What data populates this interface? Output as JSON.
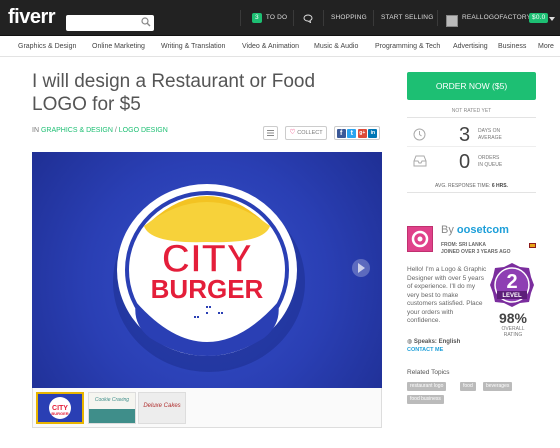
{
  "header": {
    "logo": "fiverr",
    "search_placeholder": "",
    "todo_count": "3",
    "todo_label": "TO DO",
    "shopping": "SHOPPING",
    "start_selling": "START SELLING",
    "username": "REALLOGOFACTORY",
    "balance": "$0.0"
  },
  "categories": [
    "Graphics & Design",
    "Online Marketing",
    "Writing & Translation",
    "Video & Animation",
    "Music & Audio",
    "Programming & Tech",
    "Advertising",
    "Business",
    "More"
  ],
  "gig": {
    "title": "I will design a Restaurant or Food LOGO for $5",
    "crumb_prefix": "IN",
    "crumb_cat": "GRAPHICS & DESIGN",
    "crumb_sep": "/",
    "crumb_sub": "LOGO DESIGN",
    "collect": "COLLECT",
    "logo_word1": "CITY",
    "logo_word2": "BURGER",
    "thumb_2_text": "Cookie Craving",
    "thumb_3_text": "Deluxe Cakes"
  },
  "sidebar": {
    "order_button": "ORDER NOW ($5)",
    "rating_status": "NOT RATED YET",
    "days_value": "3",
    "days_label_1": "DAYS ON",
    "days_label_2": "AVERAGE",
    "orders_value": "0",
    "orders_label_1": "ORDERS",
    "orders_label_2": "IN QUEUE",
    "response_label": "AVG. RESPONSE TIME:",
    "response_value": "6 HRS.",
    "by": "By",
    "seller_name": "oosetcom",
    "from": "FROM: SRI LANKA",
    "joined": "JOINED OVER 3 YEARS AGO",
    "bio": "Hello! I'm a Logo & Graphic Designer with over 5 years of experience. I'll do my very best to make customers satisfied. Place your orders with confidence.",
    "level_number": "2",
    "level_label": "LEVEL",
    "rating_pct": "98%",
    "overall_1": "OVERALL",
    "overall_2": "RATING",
    "speaks": "Speaks: English",
    "contact": "CONTACT ME",
    "related_title": "Related Topics",
    "tags": [
      "restaurant logo",
      "food",
      "beverages",
      "food business"
    ]
  },
  "colors": {
    "brand_green": "#1dbf73",
    "link_blue": "#1d9fd9",
    "level_purple": "#7b2d9e"
  }
}
